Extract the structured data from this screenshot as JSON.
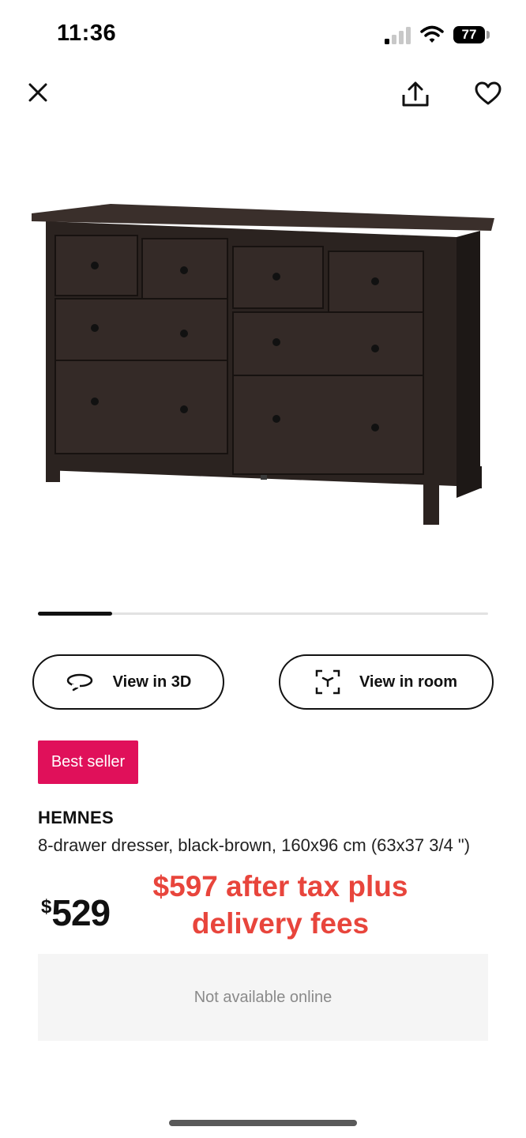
{
  "status_bar": {
    "time": "11:36",
    "battery": "77"
  },
  "header": {
    "close_icon": "close-icon",
    "share_icon": "share-icon",
    "favorite_icon": "heart-icon"
  },
  "gallery": {
    "image_alt": "HEMNES dresser product photo",
    "progress": 0.165
  },
  "actions": {
    "view_3d_label": "View in 3D",
    "view_room_label": "View in room"
  },
  "product": {
    "badge": "Best seller",
    "name": "HEMNES",
    "description": "8-drawer dresser, black-brown, 160x96 cm (63x37 3/4 \")",
    "price_currency": "$",
    "price_amount": "529",
    "annotation": "$597 after tax plus delivery fees",
    "availability": "Not available online"
  },
  "colors": {
    "badge": "#e0105a",
    "annotation": "#e8453c",
    "availability_bg": "#f5f5f5"
  }
}
